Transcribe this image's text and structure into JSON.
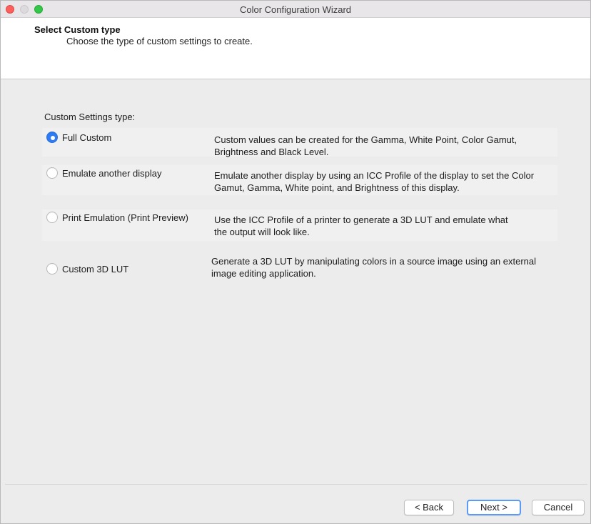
{
  "window": {
    "title": "Color Configuration Wizard"
  },
  "header": {
    "title": "Select Custom type",
    "subtitle": "Choose the type of custom settings to create."
  },
  "main": {
    "section_label": "Custom Settings type:",
    "options": [
      {
        "label": "Full Custom",
        "selected": true,
        "description_lines": [
          "Custom values can be created for the Gamma, White Point, Color Gamut,",
          "Brightness and Black Level."
        ]
      },
      {
        "label": "Emulate another display",
        "selected": false,
        "description_lines": [
          "Emulate another display by using an ICC Profile of the display to set the Color",
          "Gamut, Gamma, White point, and Brightness of this display."
        ]
      },
      {
        "label": "Print Emulation (Print Preview)",
        "selected": false,
        "description_lines": [
          "Use the ICC Profile of a printer to generate a 3D LUT and emulate what",
          "the output will look like."
        ]
      },
      {
        "label": "Custom 3D LUT",
        "selected": false,
        "description_lines": [
          "Generate a 3D LUT by manipulating colors in a source image using an external",
          "image editing application."
        ]
      }
    ]
  },
  "footer": {
    "back_label": "< Back",
    "next_label": "Next >",
    "cancel_label": "Cancel"
  },
  "colors": {
    "accent": "#2d7cf6",
    "close": "#fc605c",
    "maximize": "#34c84a",
    "default_button_ring": "#5b9af5"
  }
}
